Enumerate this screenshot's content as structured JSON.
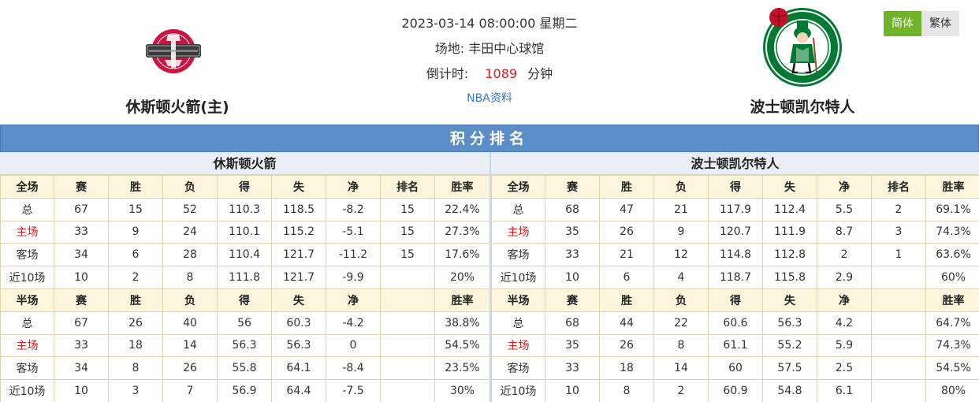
{
  "home_team": {
    "name": "休斯顿火箭(主)",
    "logo": "rockets-logo"
  },
  "away_team": {
    "name": "波士顿凯尔特人",
    "logo": "celtics-logo"
  },
  "match": {
    "datetime": "2023-03-14 08:00:00 星期二",
    "venue_label": "场地:",
    "venue": "丰田中心球馆",
    "countdown_label": "倒计时:",
    "countdown_value": "1089",
    "countdown_unit": "分钟",
    "link_label": "NBA资料"
  },
  "lang": {
    "simplified": "简体",
    "traditional": "繁体"
  },
  "colors": {
    "title_bar": "#5b8ec9",
    "header_row": "#fef6dc",
    "highlight": "#e21a1a",
    "active_lang": "#6eb32a"
  },
  "standings": {
    "title": "积分排名",
    "home": {
      "title": "休斯顿火箭",
      "full": {
        "headers": [
          "全场",
          "赛",
          "胜",
          "负",
          "得",
          "失",
          "净",
          "排名",
          "胜率"
        ],
        "rows": [
          [
            "总",
            "67",
            "15",
            "52",
            "110.3",
            "118.5",
            "-8.2",
            "15",
            "22.4%"
          ],
          [
            "主场",
            "33",
            "9",
            "24",
            "110.1",
            "115.2",
            "-5.1",
            "15",
            "27.3%"
          ],
          [
            "客场",
            "34",
            "6",
            "28",
            "110.4",
            "121.7",
            "-11.2",
            "15",
            "17.6%"
          ],
          [
            "近10场",
            "10",
            "2",
            "8",
            "111.8",
            "121.7",
            "-9.9",
            "",
            "20%"
          ]
        ]
      },
      "half": {
        "headers": [
          "半场",
          "赛",
          "胜",
          "负",
          "得",
          "失",
          "净",
          "",
          "胜率"
        ],
        "rows": [
          [
            "总",
            "67",
            "26",
            "40",
            "56",
            "60.3",
            "-4.2",
            "",
            "38.8%"
          ],
          [
            "主场",
            "33",
            "18",
            "14",
            "56.3",
            "56.3",
            "0",
            "",
            "54.5%"
          ],
          [
            "客场",
            "34",
            "8",
            "26",
            "55.8",
            "64.1",
            "-8.4",
            "",
            "23.5%"
          ],
          [
            "近10场",
            "10",
            "3",
            "7",
            "56.9",
            "64.4",
            "-7.5",
            "",
            "30%"
          ]
        ]
      }
    },
    "away": {
      "title": "波士顿凯尔特人",
      "full": {
        "headers": [
          "全场",
          "赛",
          "胜",
          "负",
          "得",
          "失",
          "净",
          "排名",
          "胜率"
        ],
        "rows": [
          [
            "总",
            "68",
            "47",
            "21",
            "117.9",
            "112.4",
            "5.5",
            "2",
            "69.1%"
          ],
          [
            "主场",
            "35",
            "26",
            "9",
            "120.7",
            "111.9",
            "8.7",
            "3",
            "74.3%"
          ],
          [
            "客场",
            "33",
            "21",
            "12",
            "114.8",
            "112.8",
            "2",
            "1",
            "63.6%"
          ],
          [
            "近10场",
            "10",
            "6",
            "4",
            "118.7",
            "115.8",
            "2.9",
            "",
            "60%"
          ]
        ]
      },
      "half": {
        "headers": [
          "半场",
          "赛",
          "胜",
          "负",
          "得",
          "失",
          "净",
          "",
          "胜率"
        ],
        "rows": [
          [
            "总",
            "68",
            "44",
            "22",
            "60.6",
            "56.3",
            "4.2",
            "",
            "64.7%"
          ],
          [
            "主场",
            "35",
            "26",
            "8",
            "61.1",
            "55.2",
            "5.9",
            "",
            "74.3%"
          ],
          [
            "客场",
            "33",
            "18",
            "14",
            "60",
            "57.5",
            "2.5",
            "",
            "54.5%"
          ],
          [
            "近10场",
            "10",
            "8",
            "2",
            "60.9",
            "54.8",
            "6.1",
            "",
            "80%"
          ]
        ]
      }
    }
  }
}
